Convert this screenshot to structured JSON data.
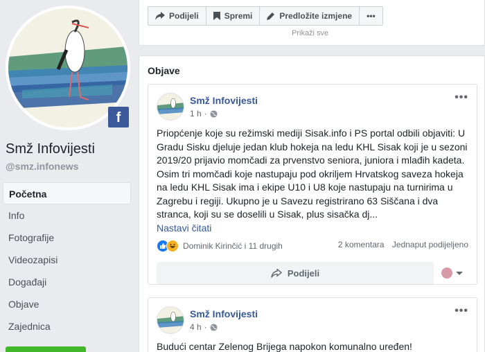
{
  "page": {
    "name": "Smž Infovijesti",
    "handle": "@smz.infonews",
    "logo_text": "SMŽ Infovijesti"
  },
  "nav": {
    "items": [
      {
        "label": "Početna"
      },
      {
        "label": "Info"
      },
      {
        "label": "Fotografije"
      },
      {
        "label": "Videozapisi"
      },
      {
        "label": "Događaji"
      },
      {
        "label": "Objave"
      },
      {
        "label": "Zajednica"
      }
    ]
  },
  "toolbar": {
    "share_label": "Podijeli",
    "save_label": "Spremi",
    "suggest_label": "Predložite izmjene",
    "more_label": "•••",
    "cutoff_text": "Prikaži sve"
  },
  "posts_section": {
    "title": "Objave"
  },
  "posts": [
    {
      "author": "Smž Infovijesti",
      "time": "1 h",
      "more_label": "•••",
      "text": "Priopćenje koje su režimski mediji Sisak.info i PS portal odbili objaviti: U Gradu Sisku djeluje jedan klub hokeja na ledu KHL Sisak koji je u sezoni 2019/20 prijavio momčadi za prvenstvo seniora, juniora i mlađih kadeta. Osim tri momčadi koje nastupaju pod okriljem Hrvatskog saveza hokeja na ledu KHL Sisak ima i ekipe U10 i U8 koje nastupaju na turnirima u Zagrebu i regiji. Ukupno je u Savezu registrirano 63 Siščana i dva stranca, koji su se doselili u Sisak, plus sisačka dj...",
      "read_more": "Nastavi čitati",
      "reactions": "Dominik Kirinčić i 11 drugih",
      "comments": "2 komentara",
      "shares": "Jednaput podijeljeno",
      "share_label": "Podijeli"
    },
    {
      "author": "Smž Infovijesti",
      "time": "4 h",
      "more_label": "•••",
      "text": "Budući centar Zelenog Brijega napokon komunalno uređen!"
    }
  ]
}
